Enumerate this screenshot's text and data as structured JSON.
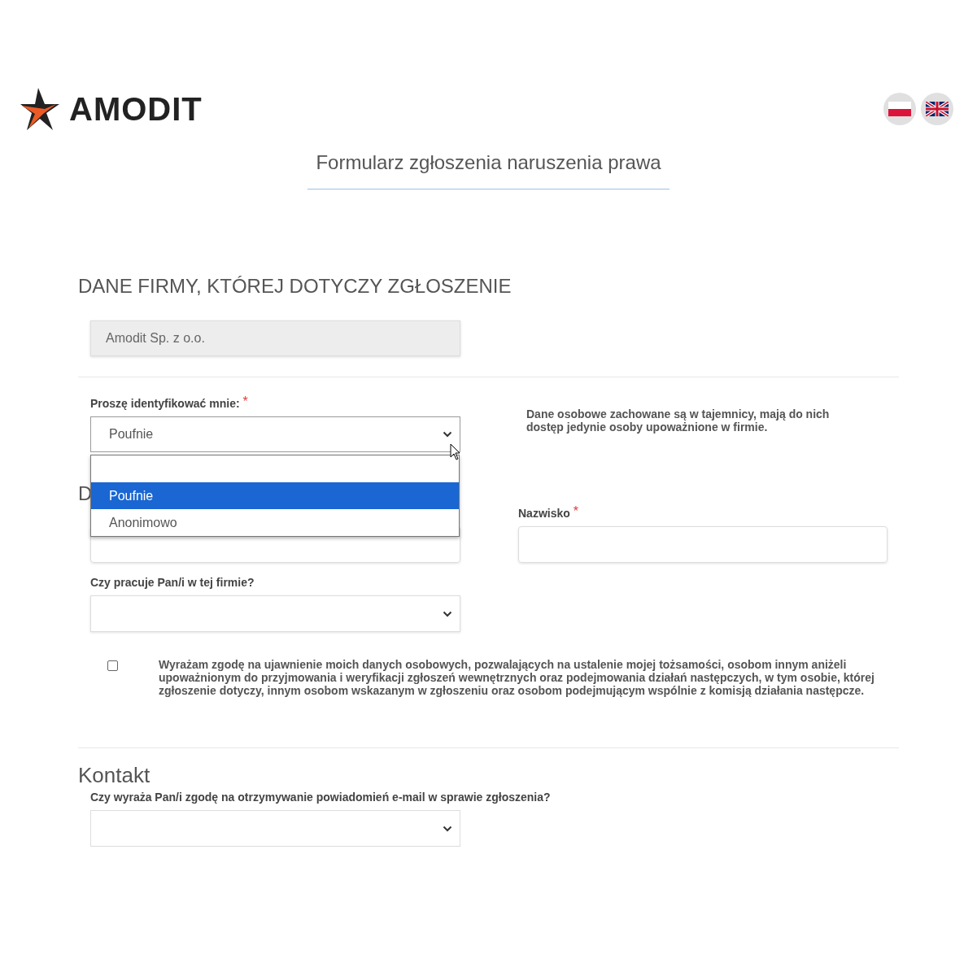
{
  "brand": {
    "name": "AMODIT"
  },
  "languages": [
    {
      "kind": "pl",
      "selected": false
    },
    {
      "kind": "en",
      "selected": false
    }
  ],
  "title": "Formularz zgłoszenia naruszenia prawa",
  "company_section": {
    "heading": "DANE FIRMY, KTÓREJ DOTYCZY ZGŁOSZENIE",
    "value": "Amodit Sp. z o.o."
  },
  "identify": {
    "label": "Proszę identyfikować mnie:",
    "required_mark": "*",
    "value": "Poufnie",
    "open": true,
    "options": [
      {
        "label": "Poufnie",
        "selected": true
      },
      {
        "label": "Anonimowo",
        "selected": false
      }
    ],
    "note": "Dane osobowe zachowane są w tajemnicy, mają do nich dostęp jedynie osoby upoważnione w firmie."
  },
  "personal_section": {
    "heading": "D"
  },
  "surname": {
    "label": "Nazwisko",
    "required_mark": "*"
  },
  "works_here": {
    "label": "Czy pracuje Pan/i w tej firmie?"
  },
  "consent": {
    "checked": false,
    "text": "Wyrażam zgodę na ujawnienie moich danych osobowych, pozwalających na ustalenie mojej tożsamości, osobom innym aniżeli upoważnionym do przyjmowania i weryfikacji zgłoszeń wewnętrznych oraz podejmowania działań następczych, w tym osobie, której zgłoszenie dotyczy, innym osobom wskazanym w zgłoszeniu oraz osobom podejmującym wspólnie z komisją działania następcze."
  },
  "contact_section": {
    "heading": "Kontakt",
    "question": {
      "label": "Czy wyraża Pan/i zgodę na otrzymywanie powiadomień e-mail w sprawie zgłoszenia?"
    }
  }
}
